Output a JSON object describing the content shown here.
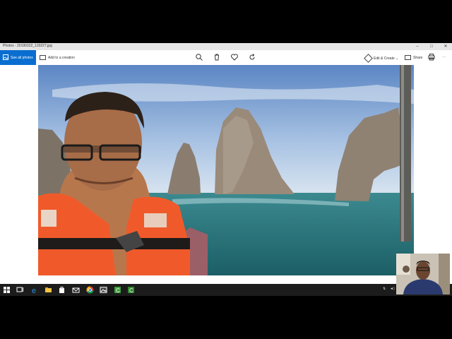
{
  "window": {
    "title": "Photos - 20190322_133227.jpg",
    "min_label": "–",
    "max_label": "□",
    "close_label": "✕"
  },
  "toolbar": {
    "see_all_label": "See all photos",
    "add_creation_label": "Add to a creation",
    "edit_create_label": "Edit & Create",
    "share_label": "Share",
    "more_label": "···"
  },
  "icons": {
    "zoom": "zoom-icon",
    "delete": "trash-icon",
    "favorite": "heart-icon",
    "rotate": "rotate-icon",
    "print": "printer-icon"
  },
  "colors": {
    "accent": "#0a6ed1",
    "taskbar": "#1c1c1c",
    "sky": "#7da1cf",
    "sea": "#1f6f76",
    "lifejacket": "#f05a2a"
  },
  "taskbar": {
    "items": [
      "start",
      "task-view",
      "edge",
      "explorer",
      "store",
      "mail",
      "chrome",
      "photos",
      "camtasia",
      "camtasia-2"
    ]
  }
}
